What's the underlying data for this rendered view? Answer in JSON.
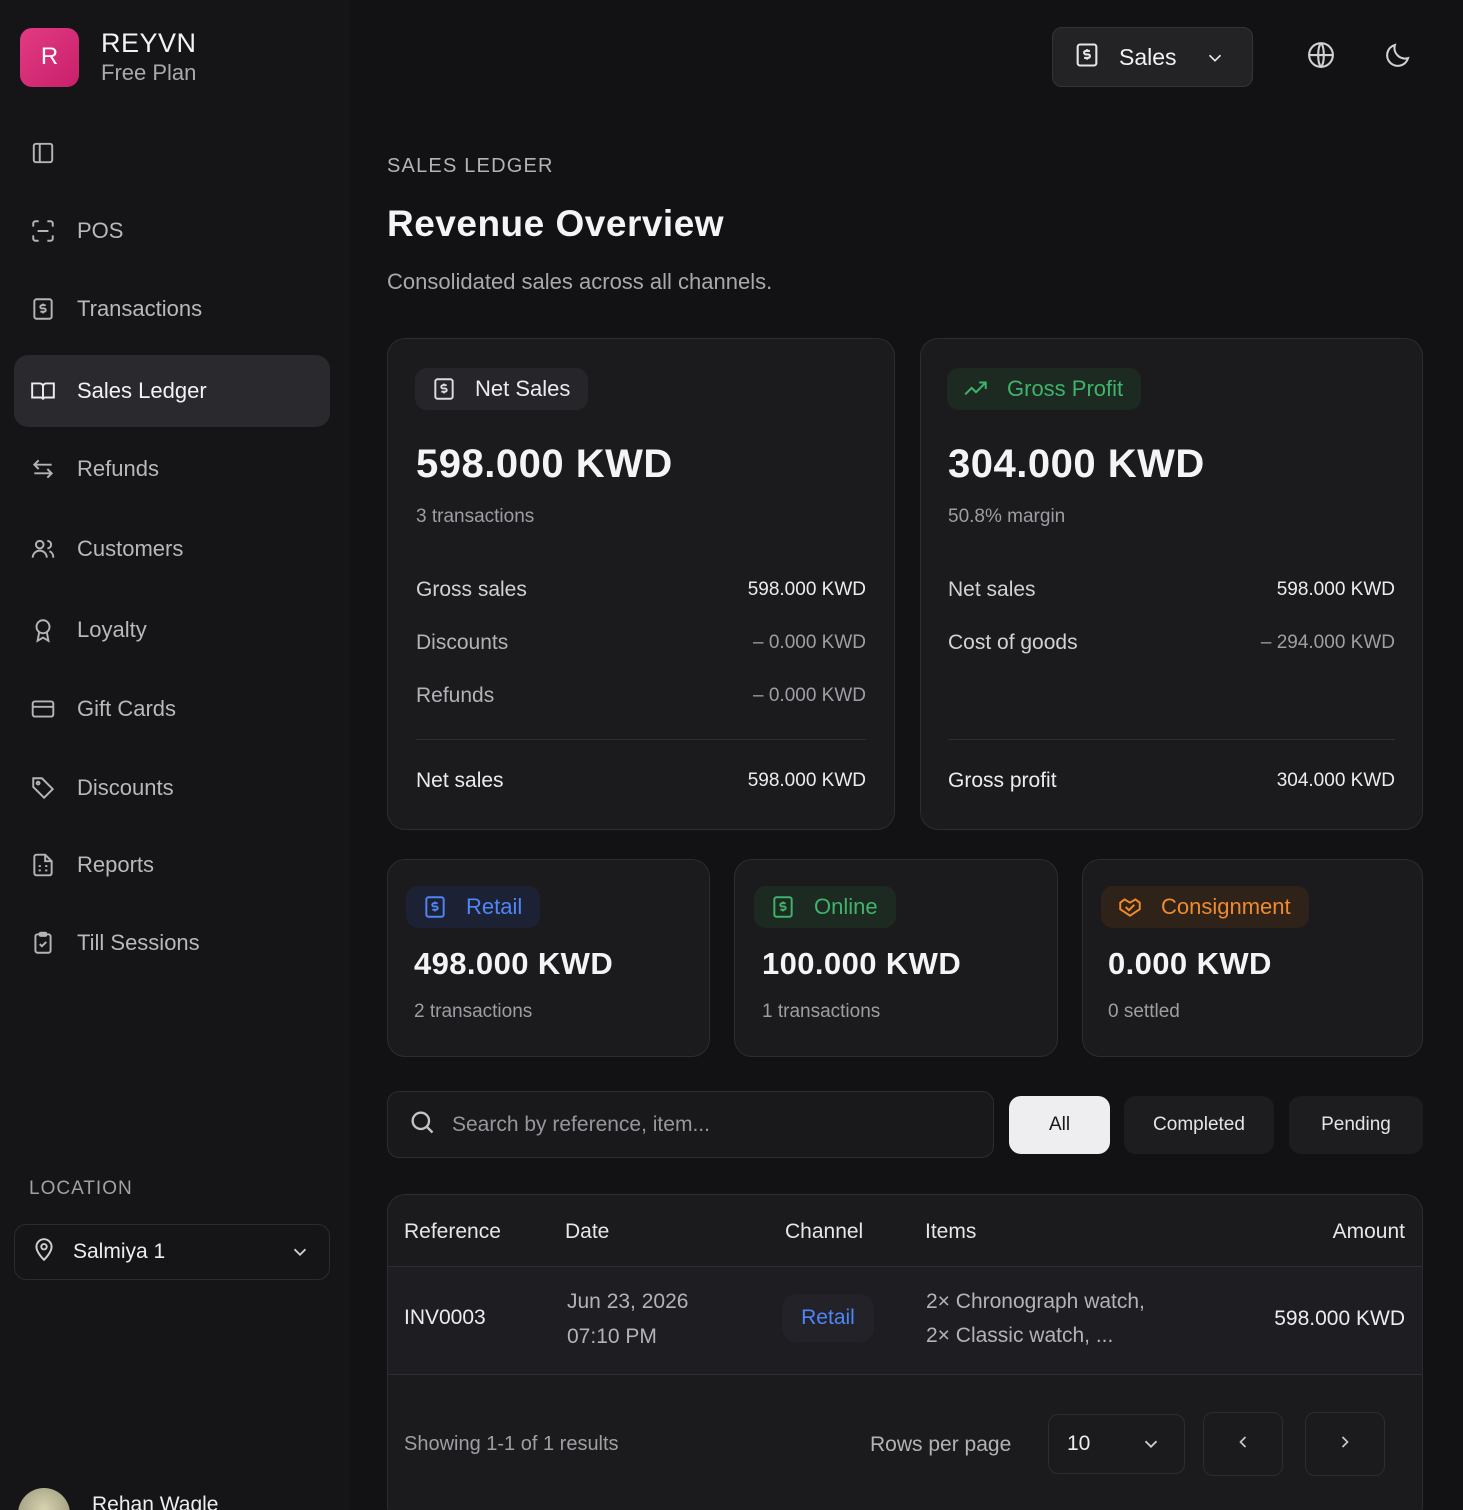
{
  "brand": {
    "initial": "R",
    "name": "REYVN",
    "plan": "Free Plan"
  },
  "sidebar": {
    "items": [
      {
        "label": "",
        "icon": "panel-toggle-icon"
      },
      {
        "label": "POS",
        "icon": "scan-icon"
      },
      {
        "label": "Transactions",
        "icon": "receipt-dollar-icon"
      },
      {
        "label": "Sales Ledger",
        "icon": "book-open-icon",
        "active": true
      },
      {
        "label": "Refunds",
        "icon": "arrows-swap-icon"
      },
      {
        "label": "Customers",
        "icon": "users-icon"
      },
      {
        "label": "Loyalty",
        "icon": "award-icon"
      },
      {
        "label": "Gift Cards",
        "icon": "credit-card-icon"
      },
      {
        "label": "Discounts",
        "icon": "tag-icon"
      },
      {
        "label": "Reports",
        "icon": "report-icon"
      },
      {
        "label": "Till Sessions",
        "icon": "clipboard-check-icon"
      }
    ],
    "location_heading": "LOCATION",
    "location_value": "Salmiya 1",
    "user_name": "Rehan Wagle"
  },
  "topbar": {
    "module_label": "Sales"
  },
  "page": {
    "kicker": "SALES LEDGER",
    "title": "Revenue Overview",
    "subtitle": "Consolidated sales across all channels."
  },
  "net_sales_card": {
    "label": "Net Sales",
    "value": "598.000 KWD",
    "sub": "3 transactions",
    "rows": [
      {
        "label": "Gross sales",
        "value": "598.000 KWD"
      },
      {
        "label": "Discounts",
        "value": "– 0.000 KWD"
      },
      {
        "label": "Refunds",
        "value": "– 0.000 KWD"
      }
    ],
    "total_label": "Net sales",
    "total_value": "598.000 KWD"
  },
  "gross_profit_card": {
    "label": "Gross Profit",
    "value": "304.000 KWD",
    "sub": "50.8% margin",
    "rows": [
      {
        "label": "Net sales",
        "value": "598.000 KWD"
      },
      {
        "label": "Cost of goods",
        "value": "– 294.000 KWD"
      }
    ],
    "total_label": "Gross profit",
    "total_value": "304.000 KWD",
    "accent": "#3fb36a"
  },
  "channels": [
    {
      "label": "Retail",
      "value": "498.000 KWD",
      "sub": "2 transactions",
      "color": "#4f86f7"
    },
    {
      "label": "Online",
      "value": "100.000 KWD",
      "sub": "1 transactions",
      "color": "#3fb36a"
    },
    {
      "label": "Consignment",
      "value": "0.000 KWD",
      "sub": "0 settled",
      "color": "#f08a2c"
    }
  ],
  "filters": {
    "search_placeholder": "Search by reference, item...",
    "tabs": [
      "All",
      "Completed",
      "Pending"
    ],
    "active_tab": "All"
  },
  "table": {
    "columns": [
      "Reference",
      "Date",
      "Channel",
      "Items",
      "Amount"
    ],
    "rows": [
      {
        "reference": "INV0003",
        "date": "Jun 23, 2026",
        "time": "07:10 PM",
        "channel": "Retail",
        "items_line1": "2× Chronograph watch,",
        "items_line2": "2× Classic watch, ...",
        "amount": "598.000 KWD"
      }
    ],
    "showing": "Showing 1-1 of 1 results",
    "rows_per_page_label": "Rows per page",
    "rows_per_page": "10"
  }
}
